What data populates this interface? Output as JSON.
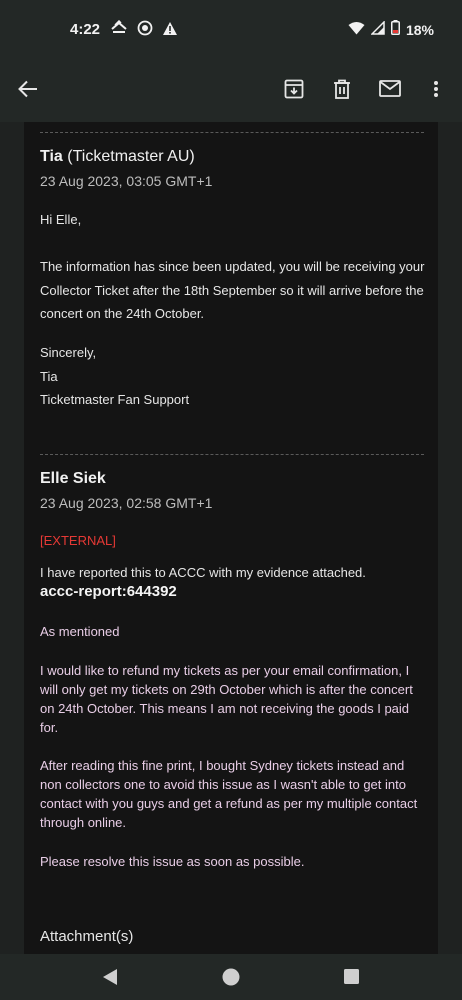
{
  "status_bar": {
    "time": "4:22",
    "battery": "18%"
  },
  "app_bar": {
    "back_icon": "arrow-back-icon",
    "archive_icon": "archive-icon",
    "delete_icon": "trash-icon",
    "mark_unread_icon": "mail-icon",
    "more_icon": "more-vertical-icon"
  },
  "messages": [
    {
      "sender_name": "Tia",
      "sender_org": "(Ticketmaster AU)",
      "date": "23 Aug 2023, 03:05 GMT+1",
      "greeting": "Hi Elle,",
      "para_lines": [
        "The information has since been updated, you will be receiving your",
        "Collector Ticket after the 18th September so it will arrive before the",
        "concert on the 24th October."
      ],
      "signoff": [
        "Sincerely,",
        "Tia",
        "Ticketmaster Fan Support"
      ]
    },
    {
      "sender_name": "Elle Siek",
      "date": "23 Aug 2023, 02:58 GMT+1",
      "external_tag": "[EXTERNAL]",
      "reported_line": "I have reported this to ACCC with my evidence attached.",
      "report_id": "accc-report:644392",
      "quoted": [
        [
          "As mentioned"
        ],
        [
          "I would like to refund my tickets as per your email confirmation, I",
          "will only get my tickets on 29th October which is after the concert",
          "on 24th October. This means I am not receiving the goods I paid",
          "for."
        ],
        [
          "After reading this fine print, I bought Sydney tickets instead and",
          "non collectors one to avoid this issue as I wasn't able to get into",
          "contact with you guys and get a refund as per my multiple contact",
          "through online."
        ],
        [
          "Please resolve this issue as soon as possible."
        ]
      ],
      "attachments_label": "Attachment(s)"
    }
  ]
}
